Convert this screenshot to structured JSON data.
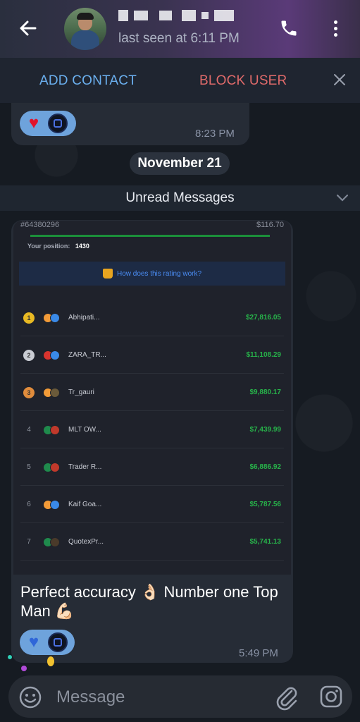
{
  "header": {
    "contact_name": "",
    "status": "last seen at 6:11 PM"
  },
  "action_bar": {
    "add_contact": "ADD CONTACT",
    "block_user": "BLOCK USER"
  },
  "messages": {
    "prev_time": "8:23 PM",
    "date_chip": "November 21",
    "unread_label": "Unread Messages",
    "photo": {
      "rank_id": "#64380296",
      "rank_amount": "$116.70",
      "position_label": "Your position:",
      "position_value": "1430",
      "info_link": "How does this rating work?",
      "leaderboard": [
        {
          "rank": "1",
          "name": "Abhipati...",
          "amount": "$27,816.05",
          "medal": "gold"
        },
        {
          "rank": "2",
          "name": "ZARA_TR...",
          "amount": "$11,108.29",
          "medal": "silver"
        },
        {
          "rank": "3",
          "name": "Tr_gauri",
          "amount": "$9,880.17",
          "medal": "bronze"
        },
        {
          "rank": "4",
          "name": "MLT OW...",
          "amount": "$7,439.99",
          "medal": ""
        },
        {
          "rank": "5",
          "name": "Trader R...",
          "amount": "$6,886.92",
          "medal": ""
        },
        {
          "rank": "6",
          "name": "Kaif Goa...",
          "amount": "$5,787.56",
          "medal": ""
        },
        {
          "rank": "7",
          "name": "QuotexPr...",
          "amount": "$5,741.13",
          "medal": ""
        }
      ]
    },
    "caption": "Perfect accuracy 👌🏻 Number one Top Man 💪🏻",
    "main_time": "5:49 PM"
  },
  "composer": {
    "placeholder": "Message"
  },
  "colors": {
    "accent_blue": "#6bb0ef",
    "danger_red": "#e06a6a",
    "money_green": "#27b34a"
  }
}
